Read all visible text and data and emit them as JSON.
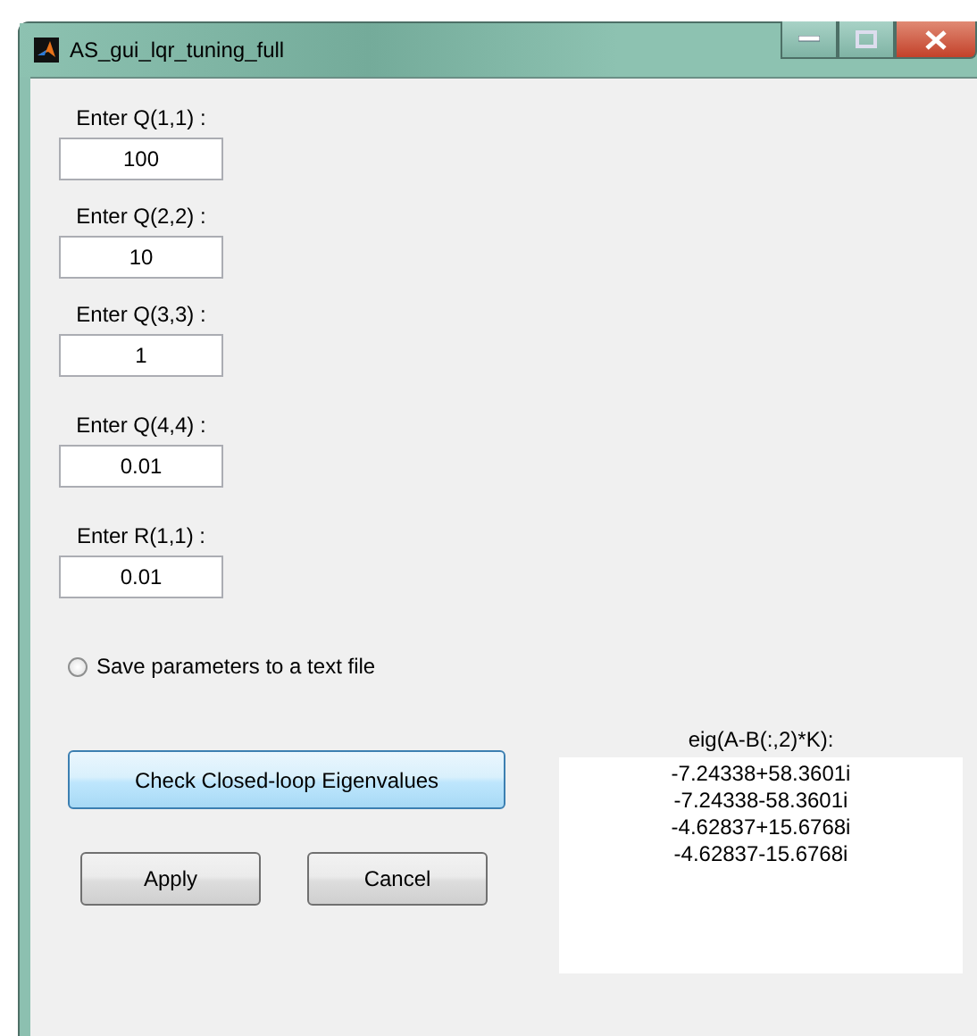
{
  "window": {
    "title": "AS_gui_lqr_tuning_full"
  },
  "fields": [
    {
      "label": "Enter Q(1,1) :",
      "value": "100"
    },
    {
      "label": "Enter Q(2,2) :",
      "value": "10"
    },
    {
      "label": "Enter Q(3,3) :",
      "value": "1"
    },
    {
      "label": "Enter Q(4,4) :",
      "value": "0.01"
    },
    {
      "label": "Enter R(1,1) :",
      "value": "0.01"
    }
  ],
  "save_option": {
    "label": "Save parameters to a text file",
    "selected": false
  },
  "check_button": "Check Closed-loop Eigenvalues",
  "buttons": [
    "Apply",
    "Cancel"
  ],
  "eigenvalues": {
    "label": "eig(A-B(:,2)*K):",
    "lines": [
      "-7.24338+58.3601i",
      "-7.24338-58.3601i",
      "-4.62837+15.6768i",
      "-4.62837-15.6768i"
    ]
  }
}
